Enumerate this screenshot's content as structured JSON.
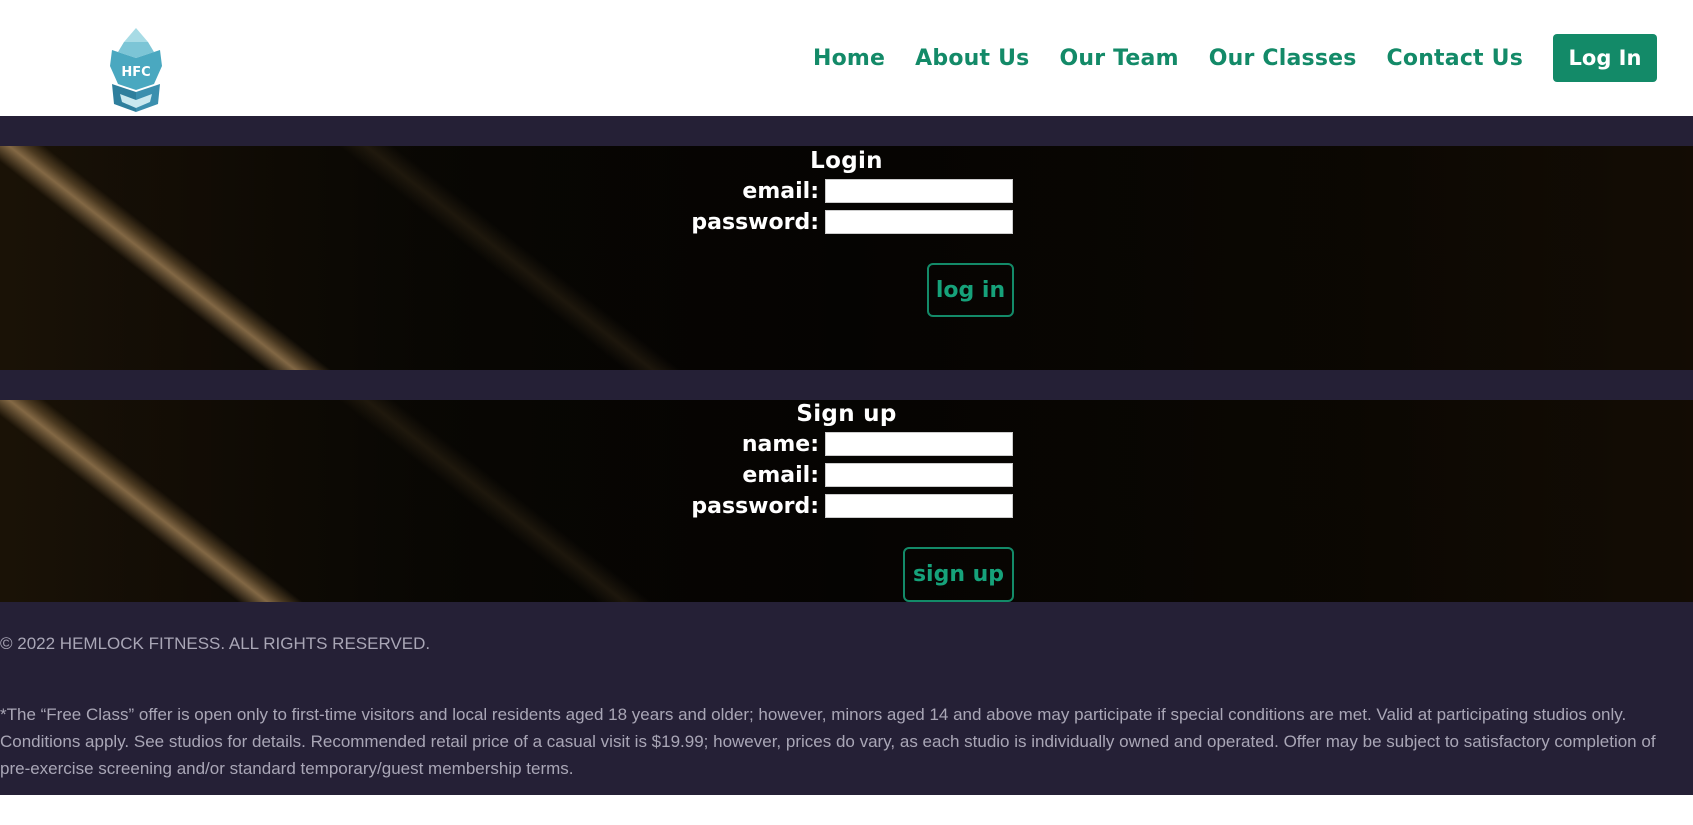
{
  "header": {
    "logo_text": "HFC",
    "nav": [
      {
        "label": "Home"
      },
      {
        "label": "About Us"
      },
      {
        "label": "Our Team"
      },
      {
        "label": "Our Classes"
      },
      {
        "label": "Contact Us"
      }
    ],
    "login_button": "Log In"
  },
  "login_form": {
    "title": "Login",
    "email_label": "email:",
    "password_label": "password:",
    "email_value": "",
    "password_value": "",
    "submit_label": "log in"
  },
  "signup_form": {
    "title": "Sign up",
    "name_label": "name:",
    "email_label": "email:",
    "password_label": "password:",
    "name_value": "",
    "email_value": "",
    "password_value": "",
    "submit_label": "sign up"
  },
  "footer": {
    "copyright": "© 2022 HEMLOCK FITNESS. ALL RIGHTS RESERVED.",
    "disclaimer": "*The “Free Class” offer is open only to first-time visitors and local residents aged 18 years and older; however, minors aged 14 and above may participate if special conditions are met. Valid at participating studios only. Conditions apply. See studios for details. Recommended retail price of a casual visit is $19.99; however, prices do vary, as each studio is individually owned and operated. Offer may be subject to satisfactory completion of pre-exercise screening and/or standard temporary/guest membership terms."
  },
  "colors": {
    "brand_green": "#138a68",
    "band_dark": "#252036",
    "logo_teal": "#4aa8c0"
  }
}
